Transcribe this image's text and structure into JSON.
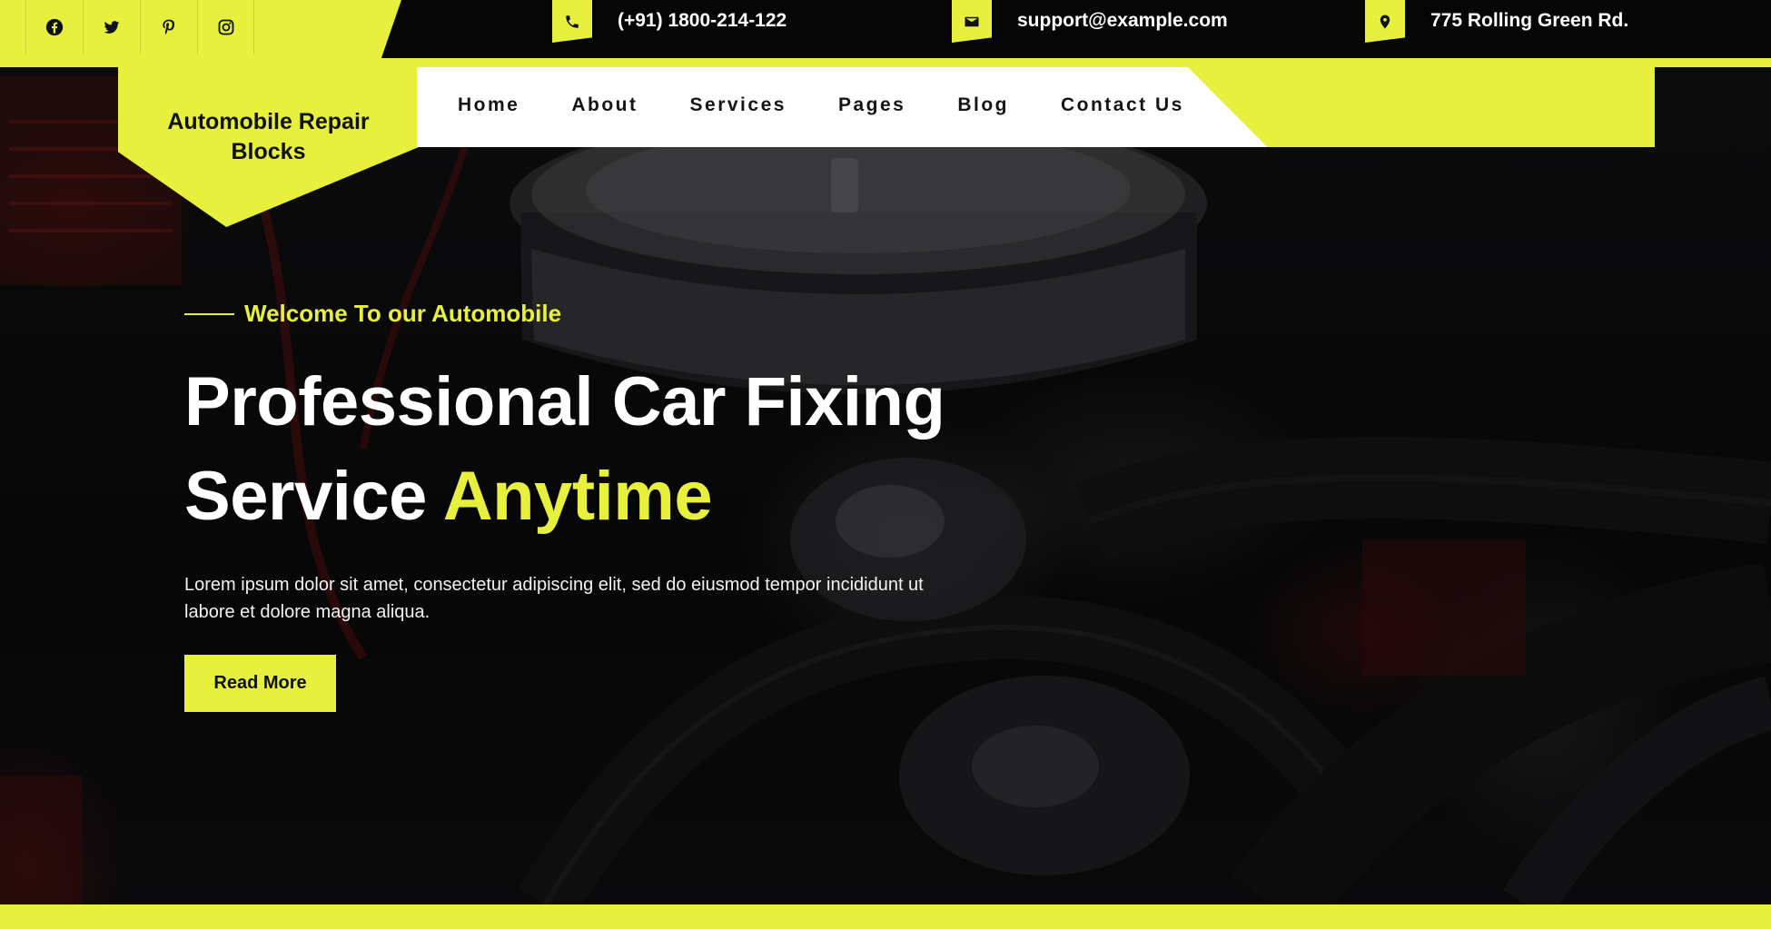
{
  "topbar": {
    "social": [
      {
        "icon": "facebook-icon"
      },
      {
        "icon": "twitter-icon"
      },
      {
        "icon": "pinterest-icon"
      },
      {
        "icon": "instagram-icon"
      }
    ],
    "phone": "(+91) 1800-214-122",
    "email": "support@example.com",
    "address": "775 Rolling Green Rd."
  },
  "brand": {
    "name": "Automobile Repair\nBlocks"
  },
  "nav": {
    "items": [
      "Home",
      "About",
      "Services",
      "Pages",
      "Blog",
      "Contact Us"
    ]
  },
  "hero": {
    "tagline": "Welcome To our Automobile",
    "headline_line1": "Professional Car Fixing",
    "headline_line2_plain": "Service",
    "headline_line2_highlight": "Anytime",
    "description": "Lorem ipsum dolor sit amet, consectetur adipiscing elit, sed do eiusmod tempor incididunt ut labore et dolore magna aliqua.",
    "cta_label": "Read More"
  },
  "colors": {
    "accent": "#e7f03c",
    "dark": "#060606",
    "white": "#ffffff"
  }
}
